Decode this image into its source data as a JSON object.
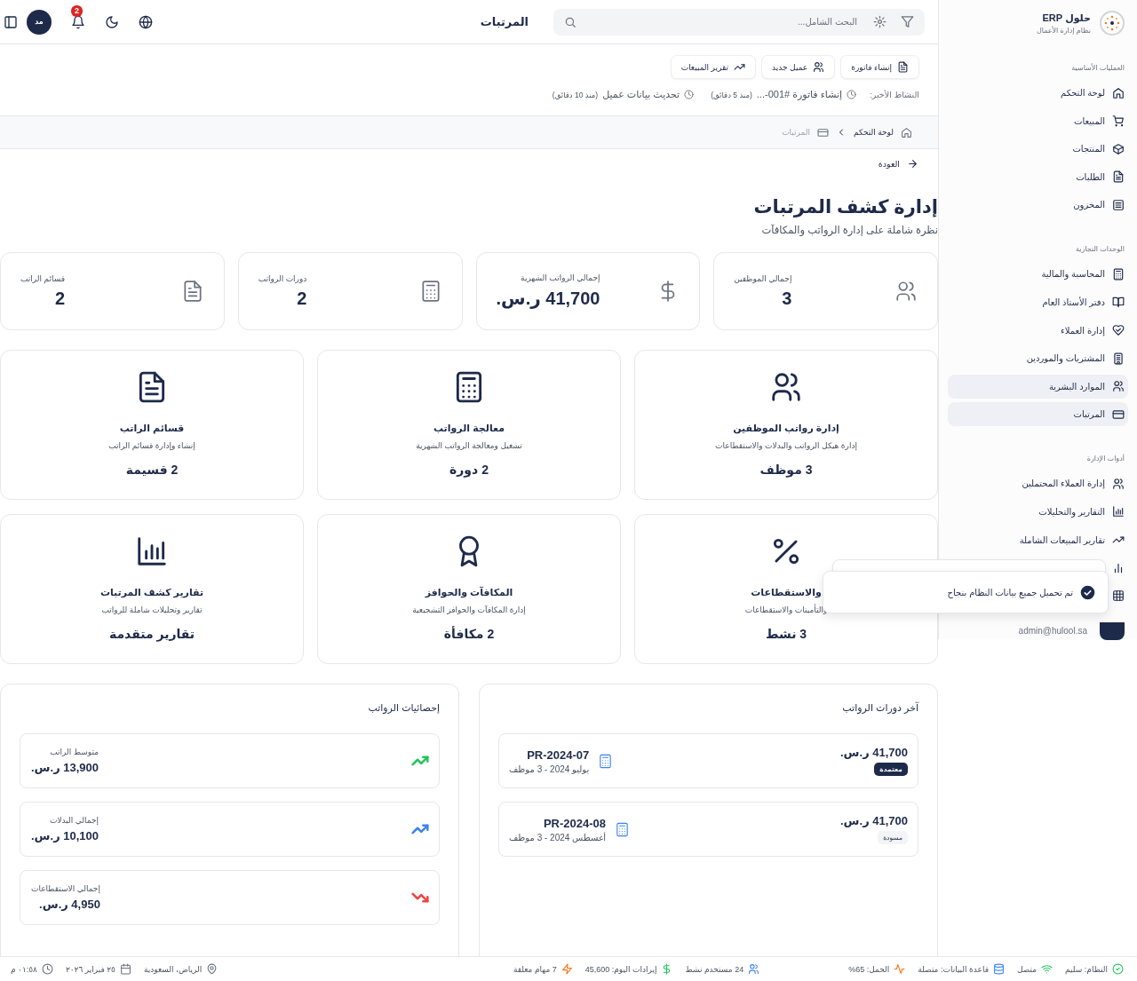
{
  "sidebar": {
    "brand": {
      "title": "حلول ERP",
      "subtitle": "نظام إدارة الأعمال"
    },
    "sections": [
      {
        "heading": "العمليات الأساسية",
        "items": [
          {
            "label": "لوحة التحكم",
            "selected": false
          },
          {
            "label": "المبيعات",
            "selected": false
          },
          {
            "label": "المنتجات",
            "selected": false
          },
          {
            "label": "الطلبات",
            "selected": false
          },
          {
            "label": "المخزون",
            "selected": false
          }
        ]
      },
      {
        "heading": "الوحدات التجارية",
        "items": [
          {
            "label": "المحاسبة والمالية",
            "selected": false
          },
          {
            "label": "دفتر الأستاذ العام",
            "selected": false
          },
          {
            "label": "إدارة العملاء",
            "selected": false
          },
          {
            "label": "المشتريات والموردين",
            "selected": false
          },
          {
            "label": "الموارد البشرية",
            "selected": true
          },
          {
            "label": "المرتبات",
            "selected": true
          }
        ]
      },
      {
        "heading": "أدوات الإدارة",
        "items": [
          {
            "label": "إدارة العملاء المحتملين",
            "selected": false
          },
          {
            "label": "التقارير والتحليلات",
            "selected": false
          },
          {
            "label": "تقارير المبيعات الشاملة",
            "selected": false
          },
          {
            "selected": false
          },
          {
            "selected": false
          }
        ]
      }
    ],
    "user": {
      "email": "admin@hulool.sa"
    }
  },
  "header": {
    "search": {
      "placeholder": "البحث الشامل..."
    },
    "title": "المرتبات",
    "avatar": "مد",
    "notifications": "2"
  },
  "quick_actions": [
    "إنشاء فاتورة",
    "عميل جديد",
    "تقرير المبيعات"
  ],
  "recent_activity": {
    "label": "النشاط الأخير:",
    "items": [
      {
        "text": "إنشاء فاتورة #001-...",
        "time": "(منذ 5 دقائق)"
      },
      {
        "text": "تحديث بيانات عميل",
        "time": "(منذ 10 دقائق)"
      }
    ]
  },
  "breadcrumb": [
    {
      "label": "لوحة التحكم",
      "selected": false
    },
    {
      "label": "المرتبات",
      "selected": true
    }
  ],
  "back": "العودة",
  "page": {
    "title": "إدارة كشف المرتبات",
    "subtitle": "نظرة شاملة على إدارة الرواتب والمكافآت"
  },
  "stats": [
    {
      "label": "إجمالي الموظفين",
      "value": "3"
    },
    {
      "label": "إجمالي الرواتب الشهرية",
      "value": "41,700 ر.س."
    },
    {
      "label": "دورات الرواتب",
      "value": "2"
    },
    {
      "label": "قسائم الراتب",
      "value": "2"
    }
  ],
  "modules": [
    {
      "title": "إدارة رواتب الموظفين",
      "description": "إدارة هيكل الرواتب والبدلات والاستقطاعات",
      "count": "3 موظف"
    },
    {
      "title": "معالجة الرواتب",
      "description": "تشغيل ومعالجة الرواتب الشهرية",
      "count": "2 دورة"
    },
    {
      "title": "قسائم الراتب",
      "description": "إنشاء وإدارة قسائم الراتب",
      "count": "2 قسيمة"
    },
    {
      "title": "والاستقطاعات",
      "description": "والتأمينات والاستقطاعات",
      "count": "3 نشط"
    },
    {
      "title": "المكافآت والحوافز",
      "description": "إدارة المكافآت والحوافز التشجيعية",
      "count": "2 مكافأة"
    },
    {
      "title": "تقارير كشف المرتبات",
      "description": "تقارير وتحليلات شاملة للرواتب",
      "count": "تقارير متقدمة"
    }
  ],
  "latest_cycles": {
    "title": "آخر دورات الرواتب",
    "items": [
      {
        "amount": "41,700 ر.س.",
        "status": "معتمدة",
        "kind": "approved",
        "code": "PR-2024-07",
        "details": "يوليو 2024 - 3 موظف"
      },
      {
        "amount": "41,700 ر.س.",
        "status": "مسودة",
        "kind": "draft",
        "code": "PR-2024-08",
        "details": "أغسطس 2024 - 3 موظف"
      }
    ]
  },
  "payroll_stats": {
    "title": "إحصائيات الرواتب",
    "items": [
      {
        "label": "متوسط الراتب",
        "value": "13,900 ر.س.",
        "kind": "up",
        "color": "#22c55e"
      },
      {
        "label": "إجمالي البدلات",
        "value": "10,100 ر.س.",
        "kind": "up",
        "color": "#3b82f6"
      },
      {
        "label": "إجمالي الاستقطاعات",
        "value": "4,950 ر.س.",
        "kind": "down",
        "color": "#ef4444"
      }
    ]
  },
  "toast": {
    "message": "تم تحميل جميع بيانات النظام بنجاح"
  },
  "status_bar": {
    "system": [
      "النظام: سليم",
      "متصل",
      "قاعدة البيانات: متصلة",
      "الحمل: 65%"
    ],
    "metrics": [
      "24 مستخدم نشط",
      "إيرادات اليوم: 45,600",
      "7 مهام معلقة"
    ],
    "info": [
      "الرياض، السعودية",
      "٢٥ فبراير ٢٠٢٦",
      "٠١:٥٨ م"
    ]
  }
}
